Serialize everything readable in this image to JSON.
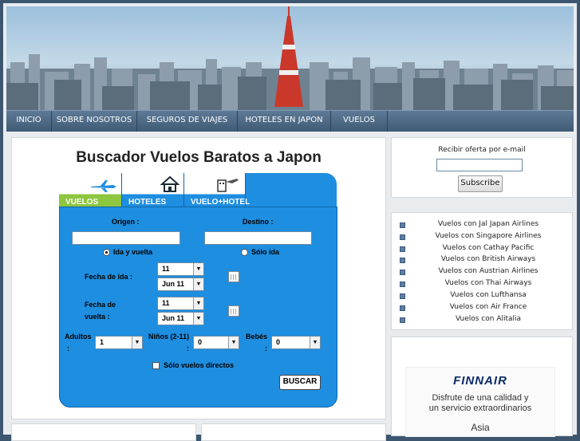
{
  "nav": {
    "items": [
      {
        "label": "INICIO"
      },
      {
        "label": "SOBRE NOSOTROS"
      },
      {
        "label": "SEGUROS DE VIAJES"
      },
      {
        "label": "HOTELES EN JAPON"
      },
      {
        "label": "VUELOS"
      }
    ]
  },
  "main": {
    "title": "Buscador Vuelos Baratos a Japon"
  },
  "widget": {
    "tabs": [
      {
        "label": "VUELOS"
      },
      {
        "label": "HOTELES"
      },
      {
        "label": "VUELO+HOTEL"
      }
    ],
    "origin_label": "Origen :",
    "destination_label": "Destino :",
    "roundtrip_label": "Ida y vuelta",
    "oneway_label": "Sólo ida",
    "depart_label": "Fecha de ida :",
    "return_label_1": "Fecha de",
    "return_label_2": "vuelta :",
    "depart_day": "11",
    "depart_month": "Jun 11",
    "return_day": "11",
    "return_month": "Jun 11",
    "adults_label": "Adultos",
    "colon": ":",
    "children_label": "Niños (2-11)",
    "babies_label": "Bebés",
    "adults_value": "1",
    "children_value": "0",
    "babies_value": "0",
    "direct_label": "Sólo vuelos directos",
    "search_button": "BUSCAR"
  },
  "newsletter": {
    "label": "Recibir oferta por e-mail",
    "button": "Subscribe"
  },
  "links": [
    "Vuelos con Jal Japan Airlines",
    "Vuelos con Singapore Airlines",
    "Vuelos con Cathay Pacific",
    "Vuelos con British Airways",
    "Vuelos con Austrian Airlines",
    "Vuelos con Thai Airways",
    "Vuelos con Lufthansa",
    "Vuelos con Air France",
    "Vuelos con Alitalia"
  ],
  "ad": {
    "brand": "FINNAIR",
    "line1": "Disfrute de una calidad y",
    "line2": "un servicio extraordinarios",
    "line3": "Asia"
  },
  "colors": {
    "accent": "#1e8ee0",
    "nav": "#4a6682",
    "active_tab": "#8dc63f"
  }
}
